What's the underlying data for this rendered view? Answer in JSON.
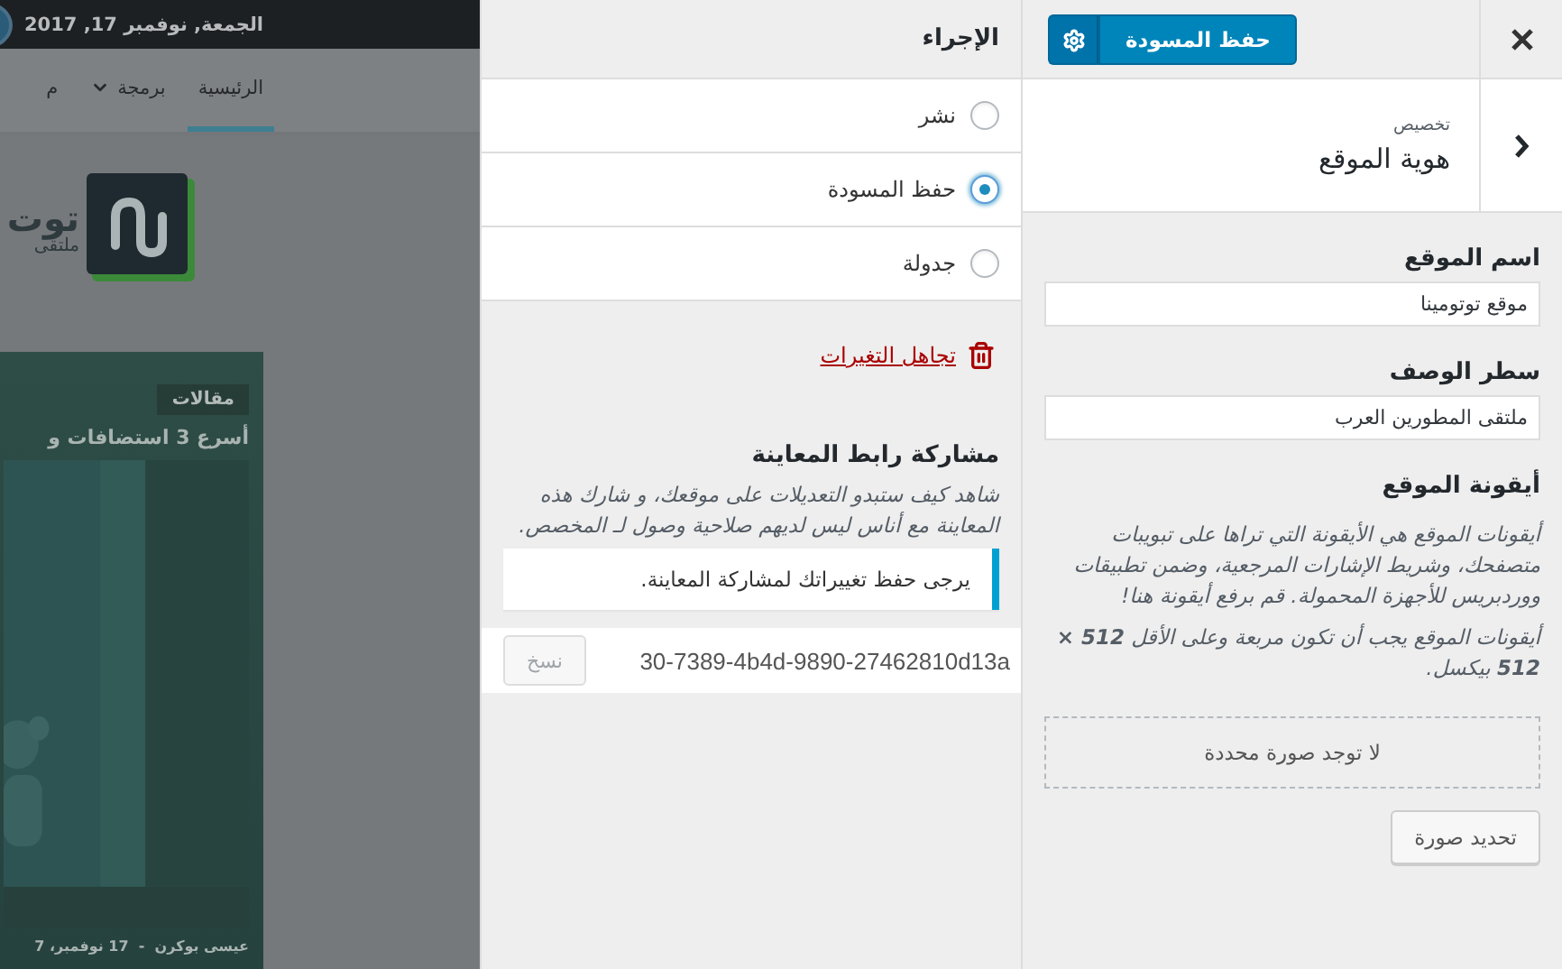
{
  "preview": {
    "date": "الجمعة, نوفمبر 17, 2017",
    "nav": [
      {
        "label": "الرئيسية",
        "selected": true,
        "has_menu": false
      },
      {
        "label": "برمجة",
        "selected": false,
        "has_menu": true
      },
      {
        "label": "م",
        "selected": false,
        "has_menu": false
      }
    ],
    "logo": {
      "title": "توت",
      "subtitle": "ملتقى"
    },
    "post": {
      "category": "مقالات",
      "title": "أسرع 3 استضافات و",
      "meta": "عيسى بوكرن  -  17 نوفمبر، 7"
    }
  },
  "publish": {
    "title": "الإجراء",
    "options": [
      {
        "label": "نشر",
        "selected": false
      },
      {
        "label": "حفظ المسودة",
        "selected": true
      },
      {
        "label": "جدولة",
        "selected": false
      }
    ],
    "discard": "تجاهل التغيرات",
    "share": {
      "title": "مشاركة رابط المعاينة",
      "description": "شاهد كيف ستبدو التعديلات على موقعك، و شارك هذه المعاينة مع أناس ليس لديهم صلاحية وصول لـ المخصص.",
      "notice": "يرجى حفظ تغييراتك لمشاركة المعاينة.",
      "url": "30-7389-4b4d-9890-27462810d13a",
      "copy": "نسخ"
    }
  },
  "customizer": {
    "save": "حفظ المسودة",
    "section": {
      "breadcrumb": "تخصيص",
      "title": "هوية الموقع"
    },
    "fields": [
      {
        "label": "اسم الموقع",
        "value": "موقع توتومينا"
      },
      {
        "label": "سطر الوصف",
        "value": "ملتقى المطورين العرب"
      }
    ],
    "site_icon": {
      "title": "أيقونة الموقع",
      "description": "أيقونات الموقع هي الأيقونة التي تراها على تبويبات متصفحك، وشريط الإشارات المرجعية، وضمن تطبيقات ووردبريس للأجهزة المحمولة. قم برفع أيقونة هنا!",
      "requirement": "أيقونات الموقع يجب أن تكون مربعة وعلى الأقل **512 × 512** بيكسل.",
      "empty": "لا توجد صورة محددة",
      "button": "تحديد صورة"
    }
  }
}
